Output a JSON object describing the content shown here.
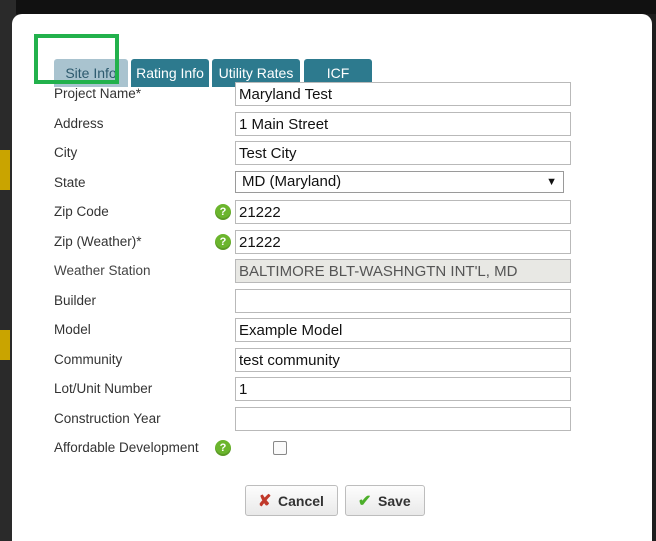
{
  "tabs": [
    {
      "label": "Site Info",
      "active": true
    },
    {
      "label": "Rating Info",
      "active": false
    },
    {
      "label": "Utility Rates",
      "active": false
    },
    {
      "label": "ICF",
      "active": false
    }
  ],
  "form": {
    "project_name": {
      "label": "Project Name*",
      "value": "Maryland Test"
    },
    "address": {
      "label": "Address",
      "value": "1 Main Street"
    },
    "city": {
      "label": "City",
      "value": "Test City"
    },
    "state": {
      "label": "State",
      "value": "MD (Maryland)"
    },
    "zip_code": {
      "label": "Zip Code",
      "value": "21222"
    },
    "zip_weather": {
      "label": "Zip (Weather)*",
      "value": "21222"
    },
    "weather_station": {
      "label": "Weather Station",
      "value": "BALTIMORE BLT-WASHNGTN INT'L, MD"
    },
    "builder": {
      "label": "Builder",
      "value": ""
    },
    "model": {
      "label": "Model",
      "value": "Example Model"
    },
    "community": {
      "label": "Community",
      "value": "test community"
    },
    "lot_unit": {
      "label": "Lot/Unit Number",
      "value": "1"
    },
    "construction_year": {
      "label": "Construction Year",
      "value": ""
    },
    "affordable": {
      "label": "Affordable Development",
      "checked": false
    }
  },
  "help_glyph": "?",
  "select_arrow": "▼",
  "buttons": {
    "cancel": {
      "label": "Cancel",
      "icon": "x-icon",
      "glyph": "✘"
    },
    "save": {
      "label": "Save",
      "icon": "checkmark-icon",
      "glyph": "✔"
    }
  },
  "colors": {
    "tab": "#2d7a8e",
    "tab_active": "#a9c3cf",
    "highlight": "#22b14c",
    "help_icon": "#6bb52d"
  }
}
